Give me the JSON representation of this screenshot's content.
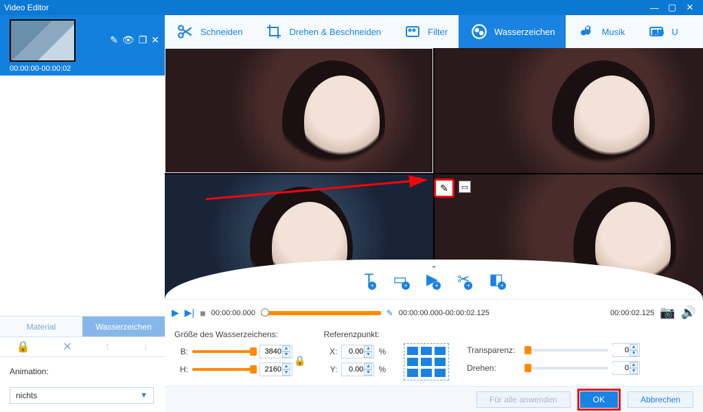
{
  "window": {
    "title": "Video Editor"
  },
  "clip": {
    "time_range": "00:00:00-00:00:02"
  },
  "sidebar": {
    "tabs": {
      "material": "Material",
      "watermark": "Wasserzeichen"
    },
    "animation_label": "Animation:",
    "animation_value": "nichts"
  },
  "toolbar": {
    "cut": "Schneiden",
    "rotate_crop": "Drehen & Beschneiden",
    "filter": "Filter",
    "watermark": "Wasserzeichen",
    "music": "Musik",
    "subtitle": "U"
  },
  "timeline": {
    "start": "00:00:00.000",
    "range": "00:00:00.000-00:00:02.125",
    "end": "00:00:02.125"
  },
  "wm": {
    "size_label": "Größe des Wasserzeichens:",
    "width_label": "B:",
    "width_value": "3840",
    "height_label": "H:",
    "height_value": "2160",
    "ref_label": "Referenzpunkt:",
    "x_label": "X:",
    "x_value": "0.00",
    "y_label": "Y:",
    "y_value": "0.00",
    "pct": "%",
    "transparency_label": "Transparenz:",
    "transparency_value": "0",
    "rotate_label": "Drehen:",
    "rotate_value": "0"
  },
  "footer": {
    "apply_all": "Für alle anwenden",
    "ok": "OK",
    "cancel": "Abbrechen"
  }
}
